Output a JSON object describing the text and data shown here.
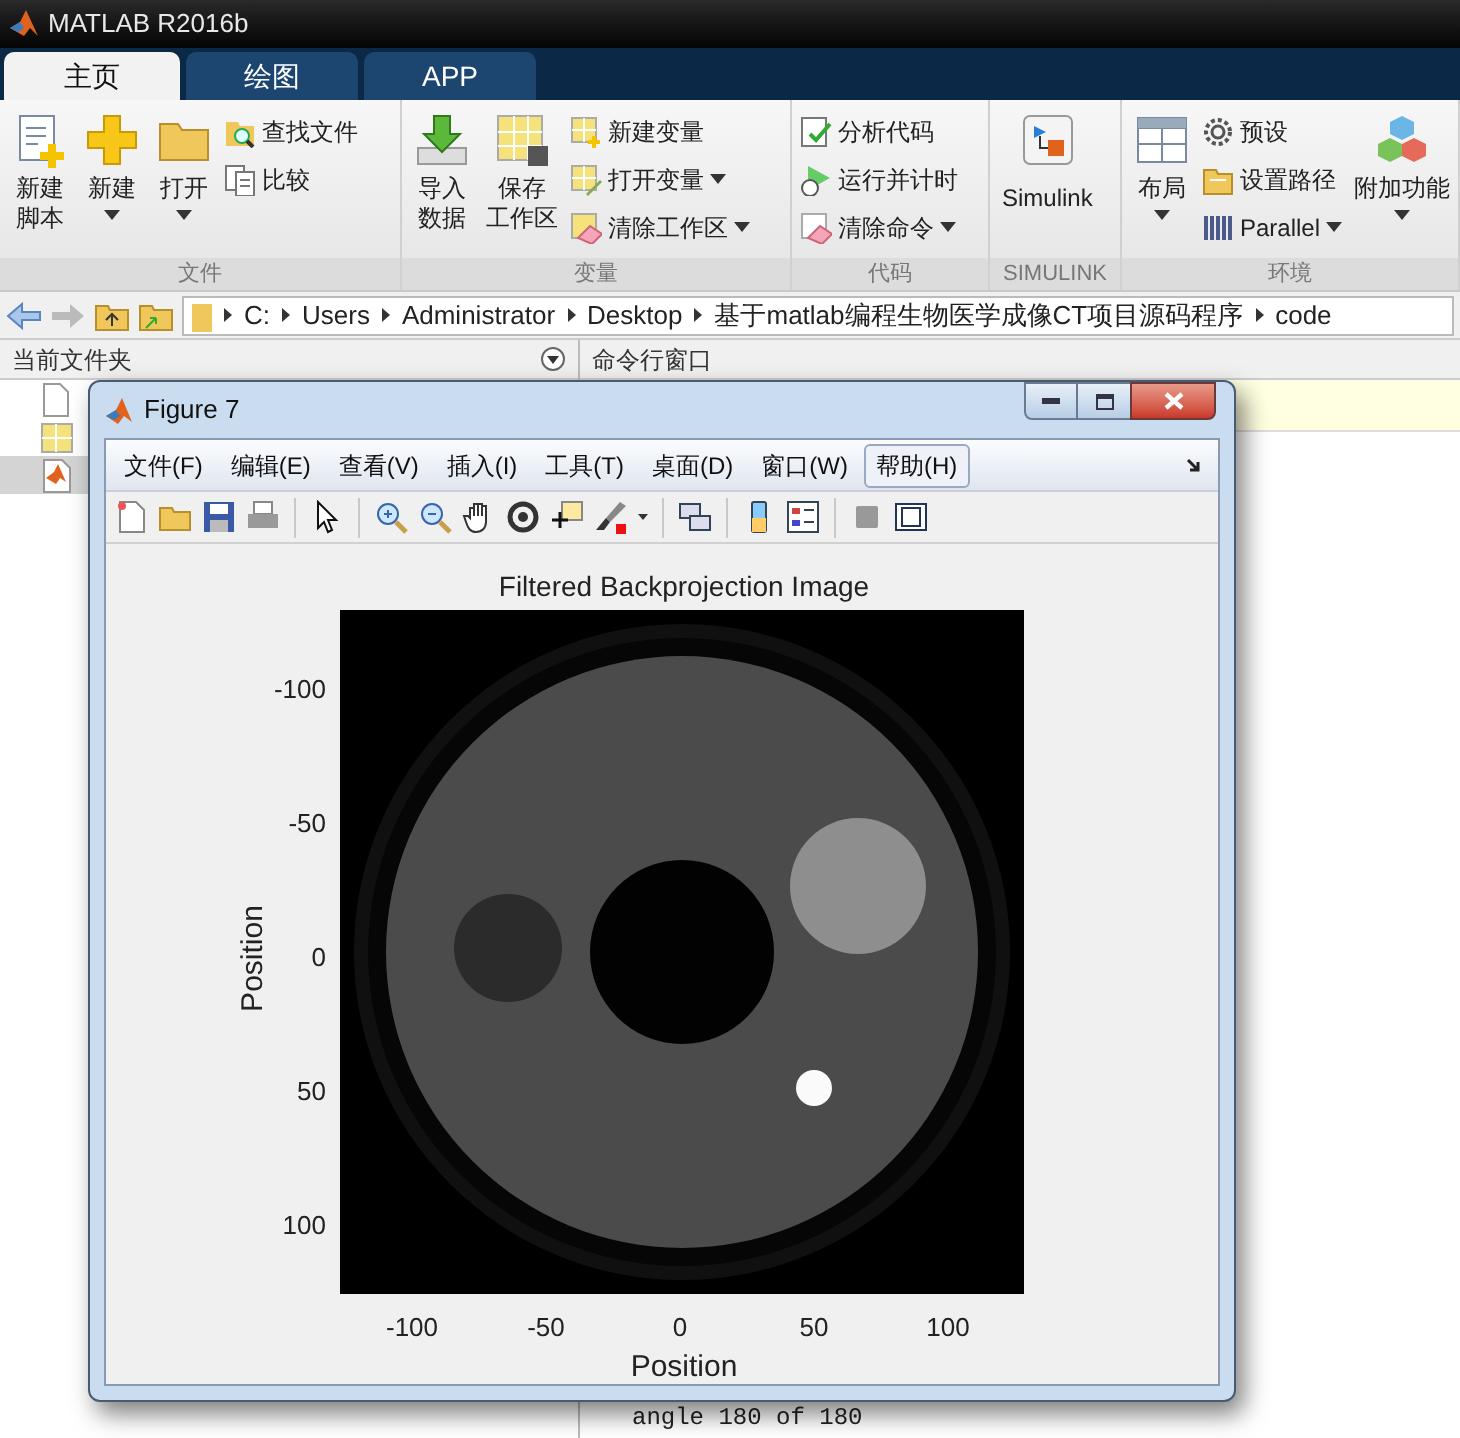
{
  "window": {
    "title": "MATLAB R2016b"
  },
  "tabs": [
    {
      "label": "主页",
      "selected": true
    },
    {
      "label": "绘图",
      "selected": false
    },
    {
      "label": "APP",
      "selected": false
    }
  ],
  "ribbon": {
    "groups": [
      {
        "label": "文件",
        "items": [
          {
            "kind": "large",
            "lines": [
              "新建",
              "脚本"
            ],
            "dropdown": false
          },
          {
            "kind": "large",
            "lines": [
              "新建"
            ],
            "dropdown": true
          },
          {
            "kind": "large",
            "lines": [
              "打开"
            ],
            "dropdown": true
          },
          {
            "kind": "small",
            "label": "查找文件",
            "dropdown": false
          },
          {
            "kind": "small",
            "label": "比较",
            "dropdown": false
          }
        ]
      },
      {
        "label": "变量",
        "items": [
          {
            "kind": "large",
            "lines": [
              "导入",
              "数据"
            ],
            "dropdown": false
          },
          {
            "kind": "large",
            "lines": [
              "保存",
              "工作区"
            ],
            "dropdown": false
          },
          {
            "kind": "small",
            "label": "新建变量",
            "dropdown": false
          },
          {
            "kind": "small",
            "label": "打开变量",
            "dropdown": true
          },
          {
            "kind": "small",
            "label": "清除工作区",
            "dropdown": true
          }
        ]
      },
      {
        "label": "代码",
        "items": [
          {
            "kind": "small",
            "label": "分析代码",
            "dropdown": false
          },
          {
            "kind": "small",
            "label": "运行并计时",
            "dropdown": false
          },
          {
            "kind": "small",
            "label": "清除命令",
            "dropdown": true
          }
        ]
      },
      {
        "label": "SIMULINK",
        "items": [
          {
            "kind": "large",
            "lines": [
              "Simulink"
            ],
            "dropdown": false
          }
        ]
      },
      {
        "label": "环境",
        "items": [
          {
            "kind": "large",
            "lines": [
              "布局"
            ],
            "dropdown": true
          },
          {
            "kind": "small",
            "label": "预设",
            "dropdown": false
          },
          {
            "kind": "small",
            "label": "设置路径",
            "dropdown": false
          },
          {
            "kind": "small",
            "label": "Parallel",
            "dropdown": true
          },
          {
            "kind": "large",
            "lines": [
              "附加功能"
            ],
            "dropdown": true
          }
        ]
      }
    ]
  },
  "address_bar": {
    "path": [
      "C:",
      "Users",
      "Administrator",
      "Desktop",
      "基于matlab编程生物医学成像CT项目源码程序",
      "code"
    ]
  },
  "current_folder": {
    "title": "当前文件夹",
    "files": [
      {
        "kind": "blank",
        "selected": false
      },
      {
        "kind": "layout",
        "selected": false
      },
      {
        "kind": "mfile",
        "selected": true
      }
    ]
  },
  "command_window": {
    "title": "命令行窗口",
    "output": "angle 180 of 180"
  },
  "figure": {
    "title": "Figure 7",
    "menu": [
      {
        "label": "文件(F)",
        "selected": false
      },
      {
        "label": "编辑(E)",
        "selected": false
      },
      {
        "label": "查看(V)",
        "selected": false
      },
      {
        "label": "插入(I)",
        "selected": false
      },
      {
        "label": "工具(T)",
        "selected": false
      },
      {
        "label": "桌面(D)",
        "selected": false
      },
      {
        "label": "窗口(W)",
        "selected": false
      },
      {
        "label": "帮助(H)",
        "selected": true
      }
    ],
    "plot": {
      "title": "Filtered Backprojection Image",
      "xlabel": "Position",
      "ylabel": "Position",
      "xticks": [
        "-100",
        "-50",
        "0",
        "50",
        "100"
      ],
      "yticks": [
        "-100",
        "-50",
        "0",
        "50",
        "100"
      ]
    }
  }
}
